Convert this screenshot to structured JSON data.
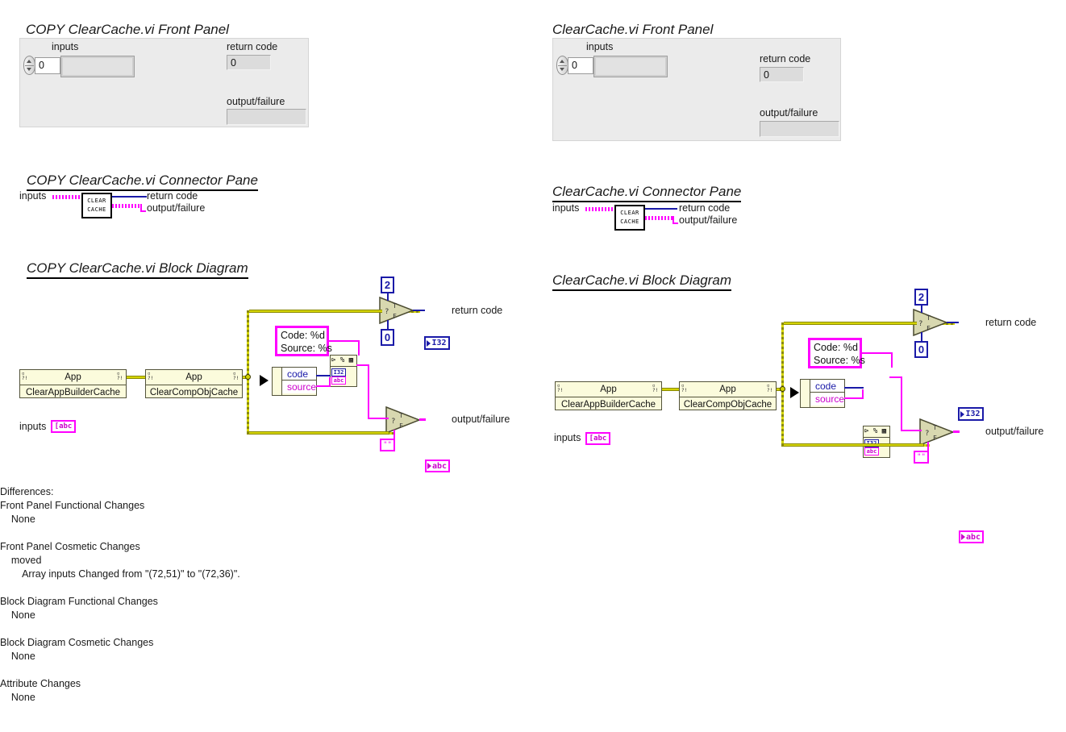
{
  "left": {
    "front_panel": {
      "title": "COPY  ClearCache.vi Front Panel",
      "inputs_label": "inputs",
      "index_value": "0",
      "return_code_label": "return code",
      "return_code_value": "0",
      "output_failure_label": "output/failure",
      "output_failure_value": ""
    },
    "connector_pane": {
      "title": "COPY  ClearCache.vi Connector Pane",
      "inputs_label": "inputs",
      "icon_line1": "CLEAR",
      "icon_line2": "CACHE",
      "return_code_label": "return code",
      "output_failure_label": "output/failure"
    },
    "block_diagram": {
      "title": "COPY  ClearCache.vi Block Diagram",
      "inputs_label": "inputs",
      "inputs_terminal_glyph": "[abc",
      "node1_header": "App",
      "node1_method": "ClearAppBuilderCache",
      "node2_header": "App",
      "node2_method": "ClearCompObjCache",
      "format_string_line1": "Code: %d",
      "format_string_line2": "Source: %s",
      "cluster_code": "code",
      "cluster_source": "source",
      "fmt_header": "%",
      "fmt_in_i32": "I32",
      "fmt_in_abc": "abc",
      "const_true_numeric": "2",
      "const_false_numeric": "0",
      "const_empty_string": "\"\"",
      "return_code_terminal": "I32",
      "return_code_label": "return code",
      "output_failure_terminal": "abc",
      "output_failure_label": "output/failure"
    }
  },
  "right": {
    "front_panel": {
      "title": "ClearCache.vi Front Panel",
      "inputs_label": "inputs",
      "index_value": "0",
      "return_code_label": "return code",
      "return_code_value": "0",
      "output_failure_label": "output/failure",
      "output_failure_value": ""
    },
    "connector_pane": {
      "title": "ClearCache.vi Connector Pane",
      "inputs_label": "inputs",
      "icon_line1": "CLEAR",
      "icon_line2": "CACHE",
      "return_code_label": "return code",
      "output_failure_label": "output/failure"
    },
    "block_diagram": {
      "title": "ClearCache.vi Block Diagram",
      "inputs_label": "inputs",
      "inputs_terminal_glyph": "[abc",
      "node1_header": "App",
      "node1_method": "ClearAppBuilderCache",
      "node2_header": "App",
      "node2_method": "ClearCompObjCache",
      "format_string_line1": "Code: %d",
      "format_string_line2": "Source: %s",
      "cluster_code": "code",
      "cluster_source": "source",
      "fmt_header": "%",
      "fmt_in_i32": "I32",
      "fmt_in_abc": "abc",
      "const_true_numeric": "2",
      "const_false_numeric": "0",
      "const_empty_string": "\"\"",
      "return_code_terminal": "I32",
      "return_code_label": "return code",
      "output_failure_terminal": "abc",
      "output_failure_label": "output/failure"
    }
  },
  "differences": {
    "heading": "Differences:",
    "lines": [
      "Front Panel Functional Changes",
      "    None",
      "",
      "Front Panel Cosmetic Changes",
      "    moved",
      "        Array inputs Changed from \"(72,51)\" to \"(72,36)\".",
      "",
      "Block Diagram Functional Changes",
      "    None",
      "",
      "Block Diagram Cosmetic Changes",
      "    None",
      "",
      "Attribute Changes",
      "    None"
    ]
  },
  "colors": {
    "wire_string": "#ff00ff",
    "wire_numeric": "#1a1aa8",
    "wire_error_cluster": "#d4d400",
    "node_background": "#fbfbdc",
    "panel_background": "#ebebeb"
  }
}
